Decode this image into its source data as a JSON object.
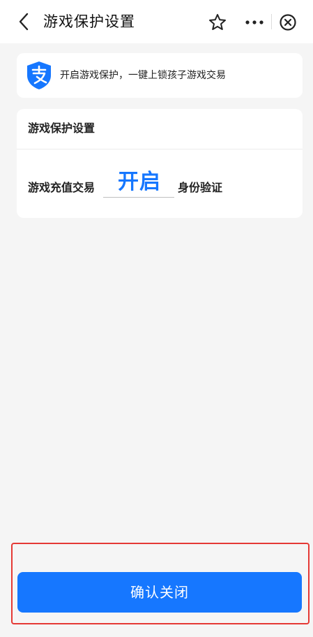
{
  "header": {
    "title": "游戏保护设置",
    "icons": [
      "back-arrow-icon",
      "star-icon",
      "more-dots-icon",
      "close-circle-icon"
    ]
  },
  "banner": {
    "icon": "alipay-shield-icon",
    "text": "开启游戏保护，一键上锁孩子游戏交易"
  },
  "card": {
    "header": "游戏保护设置",
    "row": {
      "label": "游戏充值交易",
      "value": "开启",
      "suffix": "身份验证"
    }
  },
  "footer": {
    "confirm_label": "确认关闭"
  },
  "colors": {
    "accent": "#1677ff",
    "highlight": "#e53935",
    "background": "#f5f5f5"
  }
}
